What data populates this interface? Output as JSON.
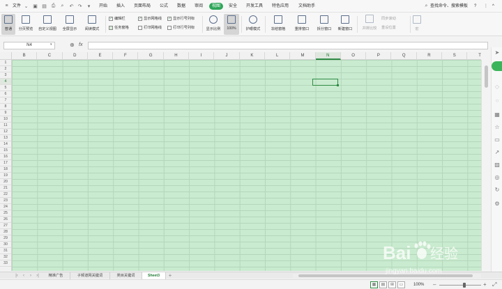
{
  "menubar": {
    "file_label": "文件",
    "tabs": [
      "开始",
      "插入",
      "页面布局",
      "公式",
      "数据",
      "审阅",
      "视图",
      "安全",
      "开发工具",
      "特色应用",
      "文档助手"
    ],
    "active_tab": "视图",
    "search_label": "查找命令、搜索模板",
    "help_glyph": "?",
    "more_glyph": "⋮",
    "collapse_glyph": "^"
  },
  "ribbon": {
    "normal": "普通",
    "page_break": "分页预览",
    "custom_view": "自定义视图",
    "fullscreen": "全屏显示",
    "reading_mode": "阅读模式",
    "checks": [
      {
        "label": "编辑栏",
        "checked": true
      },
      {
        "label": "任务窗格",
        "checked": false
      },
      {
        "label": "显示网格线",
        "checked": true
      },
      {
        "label": "打印网格线",
        "checked": false
      },
      {
        "label": "显示行号列标",
        "checked": true
      },
      {
        "label": "打印行号列标",
        "checked": false
      }
    ],
    "zoom_ratio": "显示比例",
    "zoom_100": "100%",
    "eye_mode": "护眼模式",
    "freeze": "冻结窗格",
    "arrange": "重排窗口",
    "split": "拆分窗口",
    "new_window": "新建窗口",
    "side_by_side": "并排比较",
    "sync_scroll": "同步滚动",
    "reset_pos": "重设位置",
    "macro": "宏"
  },
  "formula": {
    "cell_ref": "N4",
    "fx_label": "fx",
    "value": ""
  },
  "columns": [
    "B",
    "C",
    "D",
    "E",
    "F",
    "G",
    "H",
    "I",
    "J",
    "K",
    "L",
    "M",
    "N",
    "O",
    "P",
    "Q",
    "R",
    "S",
    "T"
  ],
  "active_column": "N",
  "rows": [
    "1",
    "2",
    "3",
    "4",
    "5",
    "6",
    "7",
    "8",
    "9",
    "10",
    "11",
    "12",
    "13",
    "14",
    "15",
    "16",
    "17",
    "18",
    "19",
    "20",
    "21",
    "22",
    "23",
    "24",
    "25",
    "26",
    "27",
    "28",
    "29",
    "30",
    "31",
    "32",
    "33"
  ],
  "active_row": "4",
  "sheets": [
    "精准广告",
    "子频道网关键词",
    "类目关键词",
    "Sheet3"
  ],
  "active_sheet": "Sheet3",
  "add_sheet": "+",
  "status": {
    "zoom": "100%",
    "zoom_minus": "–",
    "zoom_plus": "+"
  },
  "watermark": {
    "brand": "Bai",
    "brand_suffix": "经验",
    "url": "jingyan.baidu.com"
  },
  "colors": {
    "grid_bg": "#c9ebcf",
    "accent": "#2fa65a",
    "selection": "#2e8b44"
  }
}
